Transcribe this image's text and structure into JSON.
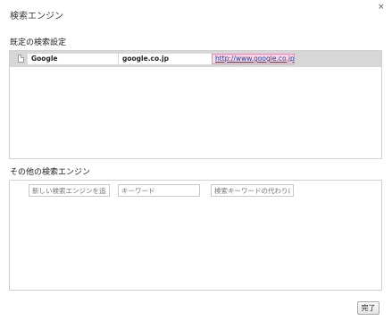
{
  "dialog": {
    "title": "検索エンジン",
    "close_glyph": "×"
  },
  "default_section": {
    "title": "既定の検索設定",
    "selected_row": {
      "name": "Google",
      "keyword": "google.co.jp",
      "url": "http://www.google.co.jp/"
    }
  },
  "other_section": {
    "title": "その他の検索エンジン",
    "new_row": {
      "name_placeholder": "新しい検索エンジンを追加",
      "keyword_placeholder": "キーワード",
      "url_placeholder": "検索キーワードの代わりに %s を入れた URL"
    }
  },
  "footer": {
    "done_label": "完了"
  }
}
